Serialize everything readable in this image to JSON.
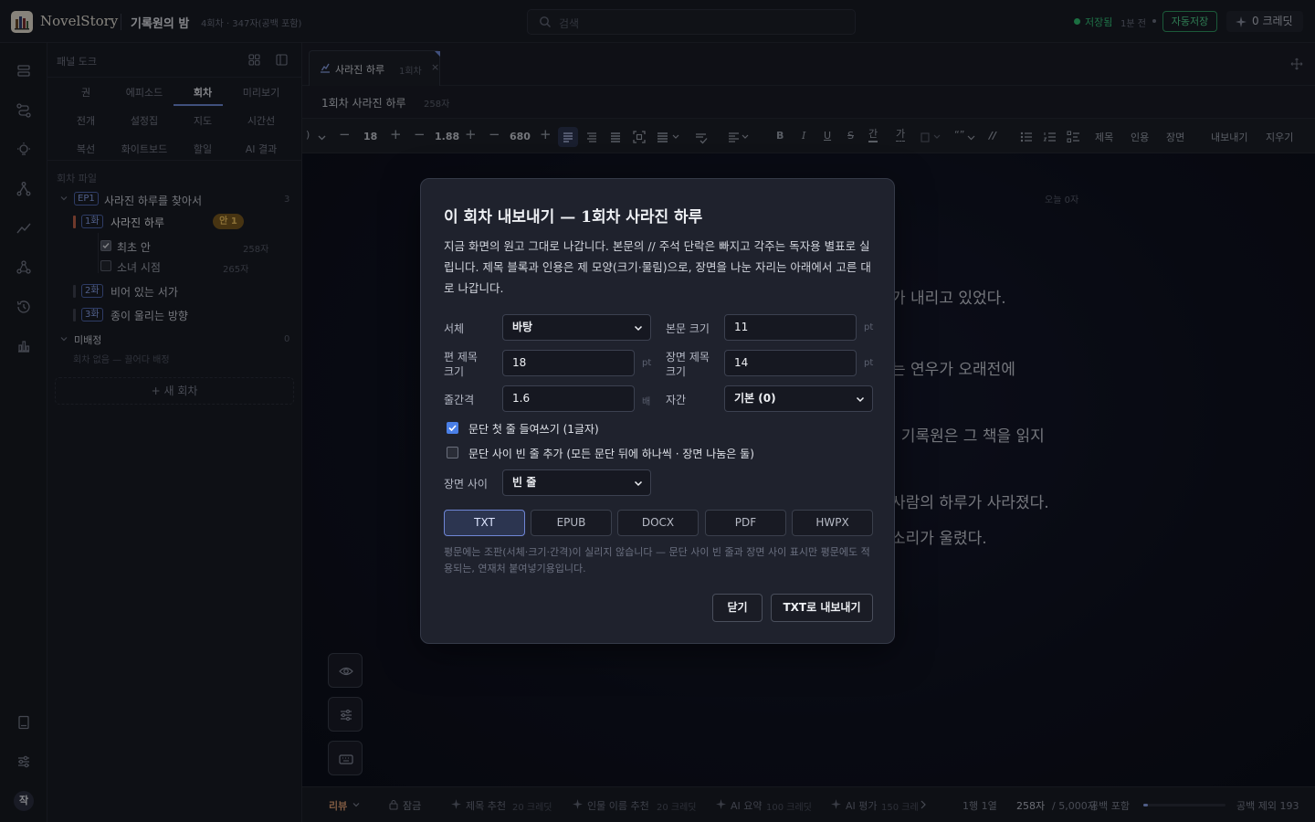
{
  "app": {
    "name": "NovelStory",
    "project_title": "기록원의 밤",
    "project_stats": "4회차 · 347자(공백 포함)"
  },
  "search": {
    "placeholder": "검색"
  },
  "save": {
    "status": "저장됨",
    "time": "1분 전",
    "autosave_label": "자동저장",
    "credits": "0 크레딧"
  },
  "panel": {
    "label": "패널 도크",
    "tabs_row1": [
      "권",
      "에피소드",
      "회차",
      "미리보기"
    ],
    "tabs_row2": [
      "전개",
      "설정집",
      "지도",
      "시간선"
    ],
    "tabs_row3": [
      "복선",
      "화이트보드",
      "할일",
      "AI 결과"
    ],
    "files_label": "회차 파일",
    "ep1": {
      "badge": "EP1",
      "title": "사라진 하루를 찾아서",
      "count": "3"
    },
    "ch1": {
      "badge": "1화",
      "title": "사라진 하루",
      "tag": "안 1"
    },
    "drafts": [
      {
        "label": "최초 안",
        "count": "258자"
      },
      {
        "label": "소녀 시점",
        "count": "265자"
      }
    ],
    "ch2": {
      "badge": "2화",
      "title": "비어 있는 서가"
    },
    "ch3": {
      "badge": "3화",
      "title": "종이 울리는 방향"
    },
    "unassigned": {
      "label": "미배정",
      "count": "0",
      "empty": "회차 없음 — 끌어다 배정"
    },
    "new_episode": "+ 새 회차"
  },
  "editor": {
    "tab_label": "사라진 하루",
    "tab_sub": "1회차",
    "tab_close": "×",
    "title": "1회차 사라진 하루",
    "title_count": "258자",
    "toolbar": {
      "font_size": "18",
      "line_height": "1.88",
      "width": "680",
      "bold": "B",
      "italic": "I",
      "underline": "U",
      "strike": "S",
      "ga1": "간",
      "ga2": "가",
      "quote_mark": "“”",
      "heading": "제목",
      "quote": "인용",
      "scene": "장면",
      "export": "내보내기",
      "clear": "지우기"
    },
    "today_count": "오늘 0자",
    "prose": [
      "가 내리고 있었다.",
      "는 연우가 오래전에",
      ". 기록원은 그 책을 읽지",
      "사람의 하루가 사라졌다.",
      "소리가 울렸다."
    ]
  },
  "status": {
    "review": "리뷰",
    "lock": "잠금",
    "ai1": "제목 추천",
    "ai1_cost": "20 크레딧",
    "ai2": "인물 이름 추천",
    "ai2_cost": "20 크레딧",
    "ai3": "AI 요약",
    "ai3_cost": "100 크레딧",
    "ai4": "AI 평가",
    "ai4_cost": "150 크레",
    "position": "1행 1열",
    "count": "258자",
    "target": "/ 5,000자",
    "count_mode": "공백 포함",
    "progress": 0.052,
    "no_space": "공백 제외 193"
  },
  "modal": {
    "title": "이 회차 내보내기 — 1회차 사라진 하루",
    "description": "지금 화면의 원고 그대로 나갑니다. 본문의 // 주석 단락은 빠지고 각주는 독자용 별표로 실립니다. 제목 블록과 인용은 제 모양(크기·물림)으로, 장면을 나눈 자리는 아래에서 고른 대로 나갑니다.",
    "font_label": "서체",
    "font_value": "바탕",
    "body_size_label": "본문 크기",
    "body_size": "11",
    "unit_pt": "pt",
    "chapter_title_label_1": "편 제목",
    "chapter_title_label_2": "크기",
    "chapter_title_size": "18",
    "scene_title_label_1": "장면 제목",
    "scene_title_label_2": "크기",
    "scene_title_size": "14",
    "line_spacing_label": "줄간격",
    "line_spacing": "1.6",
    "unit_x": "배",
    "letter_spacing_label": "자간",
    "letter_spacing": "기본 (0)",
    "indent_label": "문단 첫 줄 들여쓰기 (1글자)",
    "blank_label": "문단 사이 빈 줄 추가 (모든 문단 뒤에 하나씩 · 장면 나눔은 둘)",
    "scene_sep_label": "장면 사이",
    "scene_sep_value": "빈 줄",
    "formats": [
      "TXT",
      "EPUB",
      "DOCX",
      "PDF",
      "HWPX"
    ],
    "note": "평문에는 조판(서체·크기·간격)이 실리지 않습니다 — 문단 사이 빈 줄과 장면 사이 표시만 평문에도 적용되는, 연재처 붙여넣기용입니다.",
    "close_label": "닫기",
    "export_label": "TXT로 내보내기"
  }
}
